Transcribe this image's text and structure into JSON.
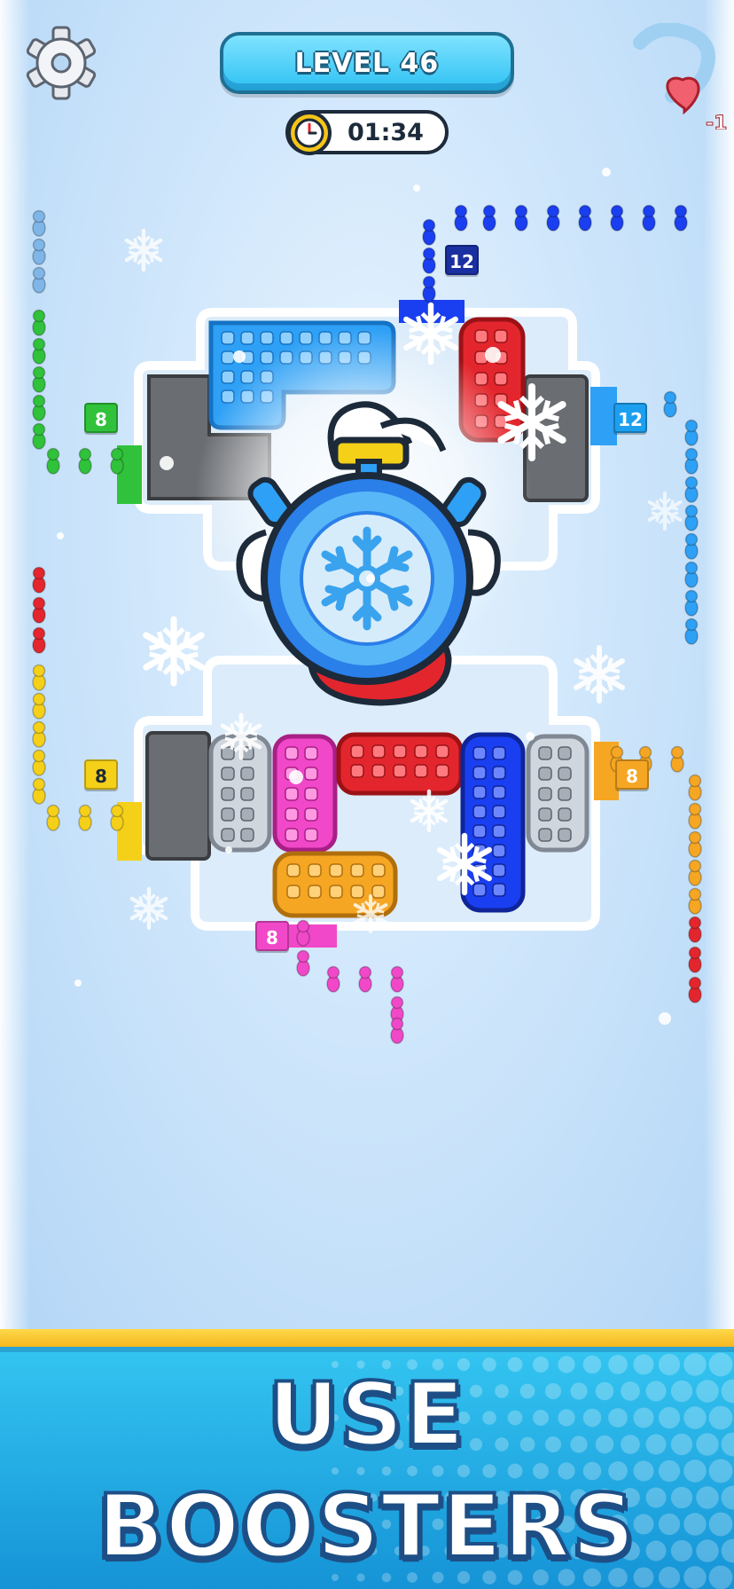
{
  "hud": {
    "level_label": "LEVEL 46",
    "timer": "01:34",
    "lives_change": "-1",
    "settings_icon": "gear-icon",
    "timer_icon": "clock-icon",
    "lives_icon": "heart-icon"
  },
  "queues": {
    "blue_top": {
      "count": "12",
      "color": "#1a3ff0"
    },
    "blue_right": {
      "count": "12",
      "color": "#1d9ff0"
    },
    "green_left": {
      "count": "8",
      "color": "#2fc23a"
    },
    "yellow_left": {
      "count": "8",
      "color": "#f5d019"
    },
    "orange_right": {
      "count": "8",
      "color": "#f5a623"
    },
    "pink_bottom": {
      "count": "8",
      "color": "#f048c8"
    }
  },
  "booster": {
    "icon": "freeze-timer-icon",
    "name": "snowflake-stopwatch"
  },
  "banner": {
    "line1": "USE",
    "line2": "BOOSTERS"
  },
  "colors": {
    "blue": "#1a3ff0",
    "sky": "#2ea0f5",
    "red": "#e3262d",
    "pink": "#f048c8",
    "orange": "#f5a623",
    "yellow": "#f5d019",
    "green": "#2fc23a",
    "gray_seat": "#cfd6de",
    "stone": "#6a6d72"
  }
}
